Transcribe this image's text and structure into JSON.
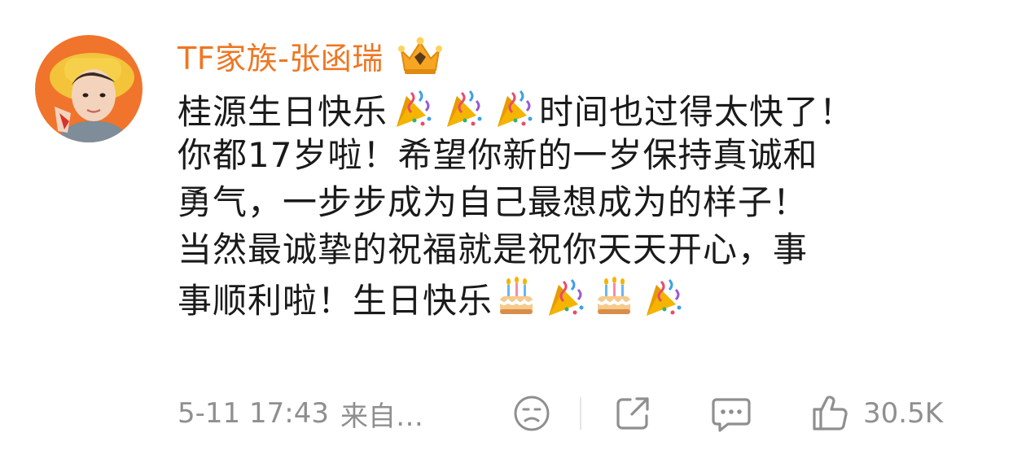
{
  "comment": {
    "username": "TF家族-张函瑞",
    "badge_icon": "crown-badge-icon",
    "text_lines": [
      [
        "桂源生日快乐",
        "🎊",
        "🎊",
        "🎊",
        "时间也过得太快了！"
      ],
      [
        "你都17岁啦！希望你新的一岁保持真诚和"
      ],
      [
        "勇气，一步步成为自己最想成为的样子！"
      ],
      [
        "当然最诚挚的祝福就是祝你天天开心，事"
      ],
      [
        "事顺利啦！生日快乐",
        "🎂",
        "🎊",
        "🎂",
        "🎊"
      ]
    ],
    "line1_a": "桂源生日快乐",
    "line1_b": "时间也过得太快了！",
    "line2": "你都17岁啦！希望你新的一岁保持真诚和",
    "line3": "勇气，一步步成为自己最想成为的样子！",
    "line4": "当然最诚挚的祝福就是祝你天天开心，事",
    "line5": "事顺利啦！生日快乐",
    "emoji_names": [
      "confetti-icon",
      "birthday-cake-icon"
    ]
  },
  "footer": {
    "time": "5-11 17:43",
    "source": "来自…",
    "like_count": "30.5K"
  },
  "colors": {
    "username": "#ee7724",
    "text": "#1a1a1a",
    "meta": "#8f8f8f",
    "avatar_bg": "#f0742c"
  }
}
